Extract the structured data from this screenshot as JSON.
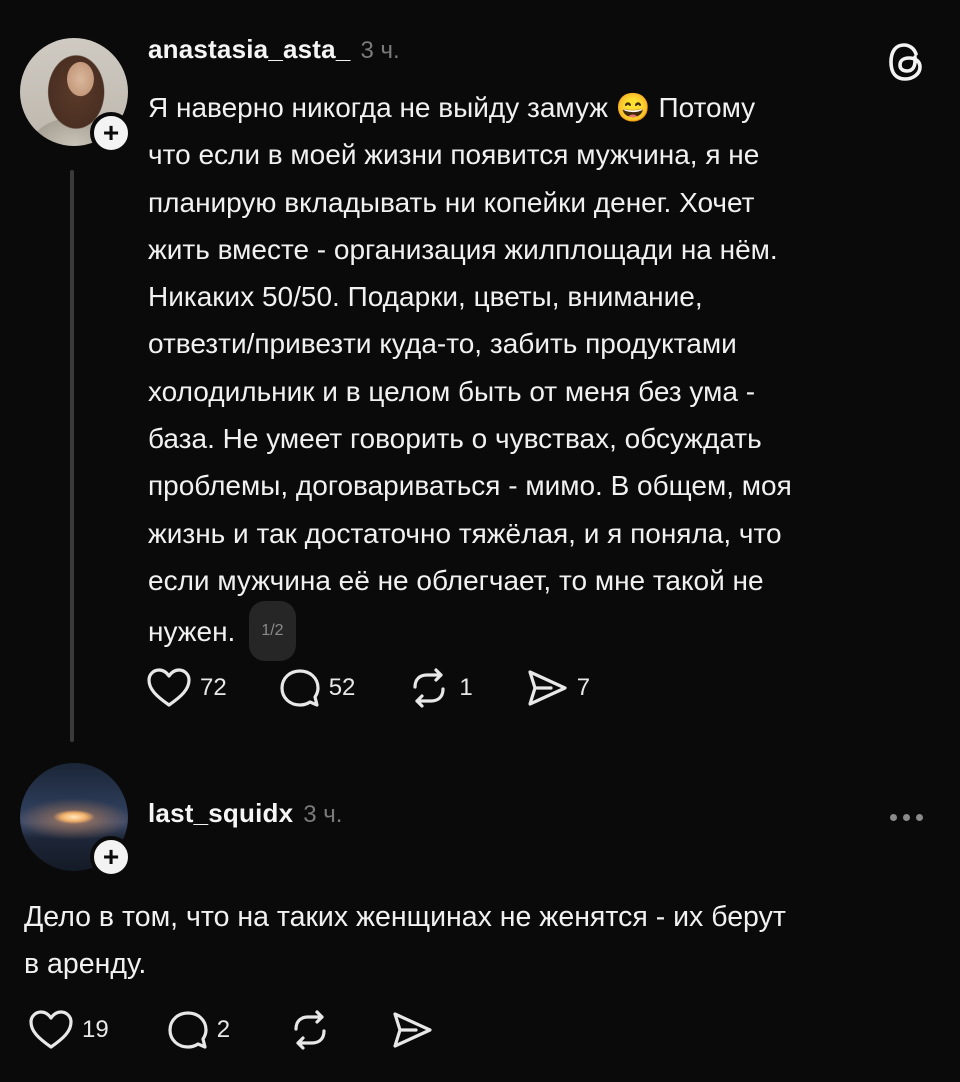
{
  "post": {
    "username": "anastasia_asta_",
    "time": "3 ч.",
    "text": "Я наверно никогда не выйду замуж 😄 Потому\nчто если в моей жизни появится мужчина, я не\nпланирую вкладывать ни копейки денег. Хочет\nжить вместе - организация жилплощади на нём.\nНикаких 50/50. Подарки, цветы, внимание,\nотвезти/привезти куда-то, забить продуктами\nхолодильник и в целом быть от меня без ума -\nбаза. Не умеет говорить о чувствах, обсуждать\nпроблемы, договариваться - мимо. В общем, моя\nжизнь и так достаточно тяжёлая, и я поняла, что\nесли мужчина её не облегчает, то мне такой не\nнужен.",
    "page_indicator": "1/2",
    "likes": "72",
    "comments": "52",
    "reposts": "1",
    "shares": "7"
  },
  "reply": {
    "username": "last_squidx",
    "time": "3 ч.",
    "text": "Дело в том, что на таких женщинах не женятся - их берут\nв аренду.",
    "likes": "19",
    "comments": "2"
  },
  "icons": {
    "brand": "threads-logo",
    "like": "heart-icon",
    "comment": "comment-icon",
    "repost": "repost-icon",
    "share": "send-icon",
    "more": "more-icon",
    "follow": "plus-icon"
  }
}
